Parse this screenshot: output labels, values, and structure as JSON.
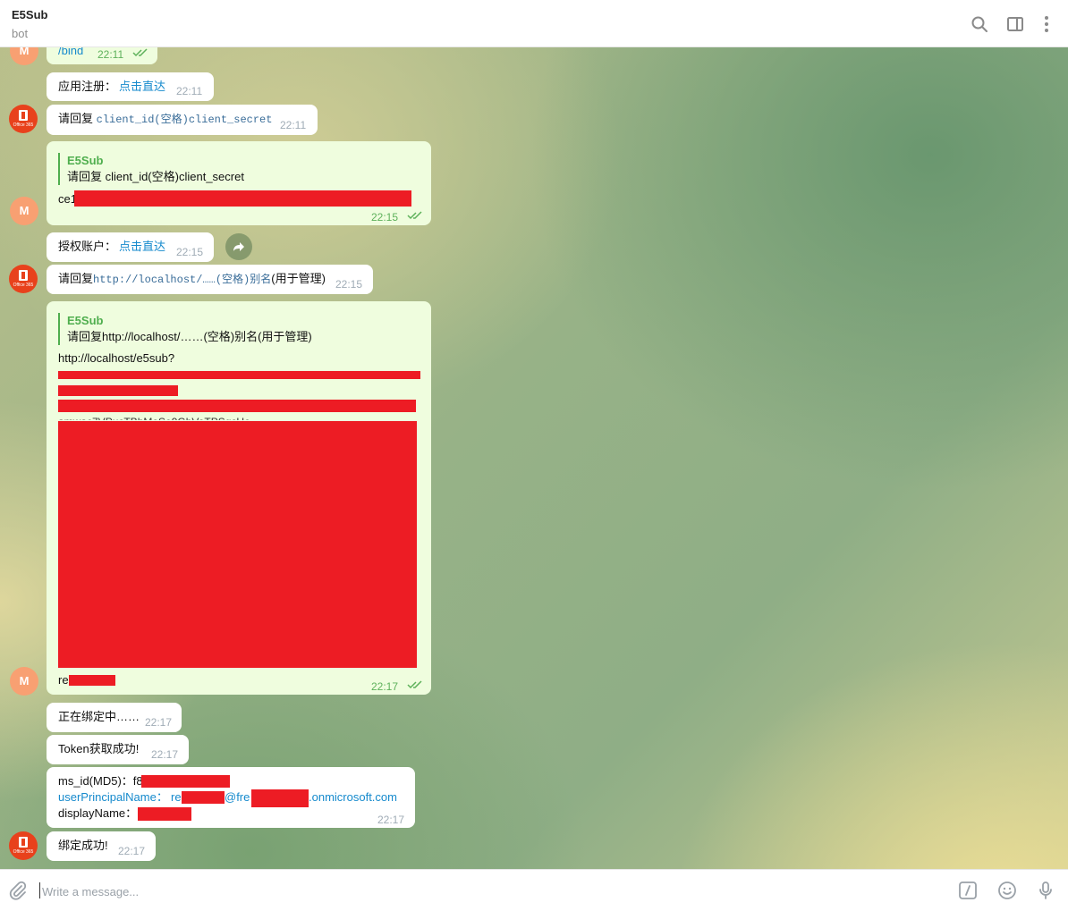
{
  "header": {
    "title": "E5Sub",
    "subtitle": "bot"
  },
  "messages": {
    "m1": {
      "text": "/bind",
      "time": "22:11"
    },
    "m2": {
      "label": "应用注册：",
      "link": "点击直达",
      "time": "22:11"
    },
    "m3": {
      "prefix": "请回复 ",
      "code": "client_id(空格)client_secret",
      "time": "22:11"
    },
    "m4": {
      "quote_name": "E5Sub",
      "quote_text": "请回复 client_id(空格)client_secret",
      "text": "ce1",
      "time": "22:15"
    },
    "m5": {
      "label": "授权账户：",
      "link": "点击直达",
      "time": "22:15"
    },
    "m6": {
      "prefix": "请回复",
      "code": "http://localhost/……(空格)别名",
      "suffix": "(用于管理)",
      "time": "22:15"
    },
    "m7": {
      "quote_name": "E5Sub",
      "quote_text": "请回复http://localhost/……(空格)别名(用于管理)",
      "line1": "http://localhost/e5sub?",
      "line_partial": "amwac7VPucTBhMoSe9GbVoTPSgcUe",
      "last": "re",
      "time": "22:17"
    },
    "m8": {
      "text": "正在绑定中……",
      "time": "22:17"
    },
    "m9": {
      "text": "Token获取成功!",
      "time": "22:17"
    },
    "m10": {
      "ms_id_label": "ms_id(MD5)：f8",
      "upn_label": "userPrincipalName：",
      "upn_pre": "re",
      "upn_mid": "@fre",
      "upn_domain": ".onmicrosoft.com",
      "display_label": "displayName：",
      "time": "22:17"
    },
    "m11": {
      "text": "绑定成功!",
      "time": "22:17"
    }
  },
  "avatars": {
    "user_initial": "M",
    "bot_caption": "Office 365"
  },
  "composer": {
    "placeholder": "Write a message..."
  },
  "colors": {
    "outgoing_bubble": "#effdde",
    "incoming_bubble": "#ffffff",
    "link": "#168acd",
    "redaction": "#ed1c24",
    "read_ticks": "#5eb15b",
    "user_avatar": "#f8a072",
    "bot_avatar": "#e8411c"
  },
  "icons": {
    "search": "search-icon",
    "side_panel": "sidebar-icon",
    "menu": "more-vertical-icon",
    "attach": "paperclip-icon",
    "commands": "slash-command-icon",
    "emoji": "emoji-icon",
    "microphone": "microphone-icon",
    "forward": "forward-icon"
  }
}
